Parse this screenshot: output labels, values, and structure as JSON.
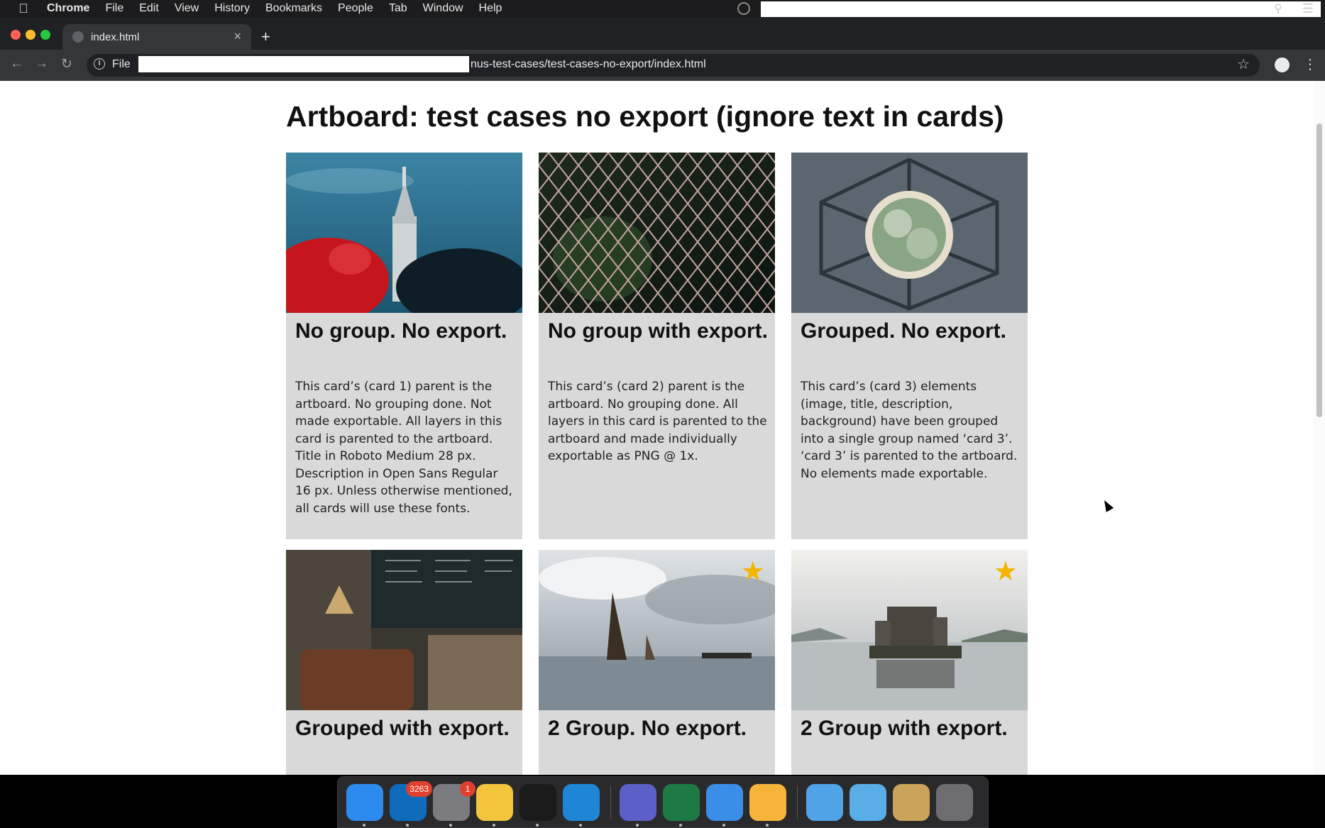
{
  "menubar": {
    "apple_icon": "apple-logo-icon",
    "app_name": "Chrome",
    "items": [
      "File",
      "Edit",
      "View",
      "History",
      "Bookmarks",
      "People",
      "Tab",
      "Window",
      "Help"
    ]
  },
  "browser": {
    "tab_title": "index.html",
    "new_tab_label": "+",
    "tab_close": "×",
    "address_scheme": "File",
    "address_url": "nus-test-cases/test-cases-no-export/index.html"
  },
  "page": {
    "title": "Artboard: test cases no export (ignore text in cards)",
    "cards": [
      {
        "title": "No group. No export.",
        "description": "This card’s (card 1) parent is the artboard. No grouping done. Not made exportable. All layers in this card is parented to the artboard. Title in Roboto Medium 28 px. Description in Open Sans Regular 16 px. Unless otherwise mentioned, all cards will use these fonts.",
        "image": "castle-tower-photo",
        "starred": false
      },
      {
        "title": "No group with export.",
        "description": "This card’s (card 2) parent is the artboard. No grouping done. All layers in this card is parented to the artboard and made individually exportable as PNG @ 1x.",
        "image": "chain-fence-photo",
        "starred": false
      },
      {
        "title": "Grouped. No export.",
        "description": "This card’s (card 3) elements (image, title, description, background) have been grouped into a single group named ‘card 3’. ‘card 3’ is parented to the artboard. No elements made exportable.",
        "image": "cactus-pot-photo",
        "starred": false
      },
      {
        "title": "Grouped with export.",
        "description": "",
        "image": "cafe-interior-photo",
        "starred": false
      },
      {
        "title": "2 Group. No export.",
        "description": "",
        "image": "sailboats-sea-photo",
        "starred": true
      },
      {
        "title": "2 Group with export.",
        "description": "",
        "image": "castle-lake-photo",
        "starred": true
      }
    ]
  },
  "dock": {
    "items": [
      {
        "name": "finder-icon",
        "color": "#2d8bf0",
        "badge": ""
      },
      {
        "name": "outlook-icon",
        "color": "#0f6cbd",
        "badge": "3263"
      },
      {
        "name": "system-preferences-icon",
        "color": "#7c7c80",
        "badge": "1"
      },
      {
        "name": "chrome-icon",
        "color": "#f2c53d",
        "badge": ""
      },
      {
        "name": "terminal-icon",
        "color": "#1b1b1b",
        "badge": ""
      },
      {
        "name": "vscode-icon",
        "color": "#1f86d6",
        "badge": ""
      },
      {
        "name": "teams-icon",
        "color": "#5b5fc7",
        "badge": ""
      },
      {
        "name": "excel-icon",
        "color": "#1d7a45",
        "badge": ""
      },
      {
        "name": "fork-icon",
        "color": "#3b8ee8",
        "badge": ""
      },
      {
        "name": "sketch-icon",
        "color": "#f7b43a",
        "badge": ""
      },
      {
        "name": "applications-folder-icon",
        "color": "#4fa3e6",
        "badge": ""
      },
      {
        "name": "documents-folder-icon",
        "color": "#5aaee8",
        "badge": ""
      },
      {
        "name": "archive-utility-icon",
        "color": "#c9a45a",
        "badge": ""
      },
      {
        "name": "trash-icon",
        "color": "#6e6e70",
        "badge": ""
      }
    ]
  }
}
